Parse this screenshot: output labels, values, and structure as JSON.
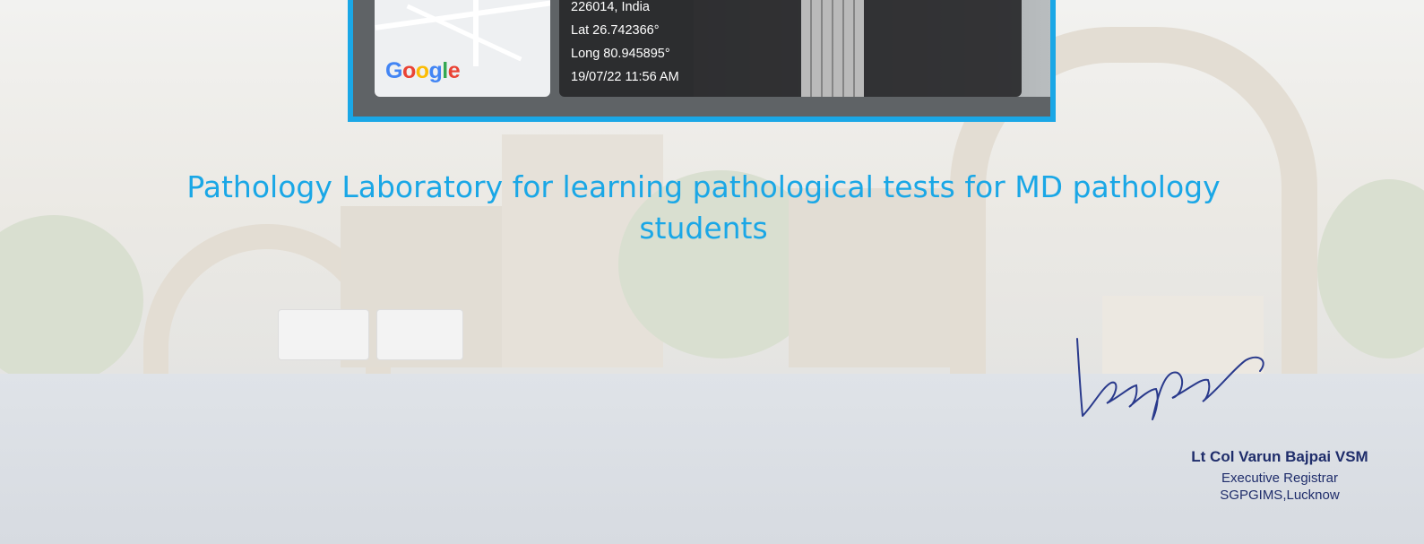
{
  "photo": {
    "map_logo": [
      "G",
      "o",
      "o",
      "g",
      "l",
      "e"
    ],
    "pincode_line": "226014, India",
    "latitude": "Lat 26.742366°",
    "longitude": "Long 80.945895°",
    "timestamp": "19/07/22 11:56 AM"
  },
  "caption": {
    "line1": "Pathology Laboratory for learning pathological tests for MD pathology",
    "line2": "students"
  },
  "signature": {
    "name": "Lt Col Varun Bajpai VSM",
    "designation": "Executive Registrar",
    "institute": "SGPGIMS,Lucknow"
  },
  "colors": {
    "accent": "#1aa7e6",
    "signature_ink": "#1f2d6b"
  }
}
